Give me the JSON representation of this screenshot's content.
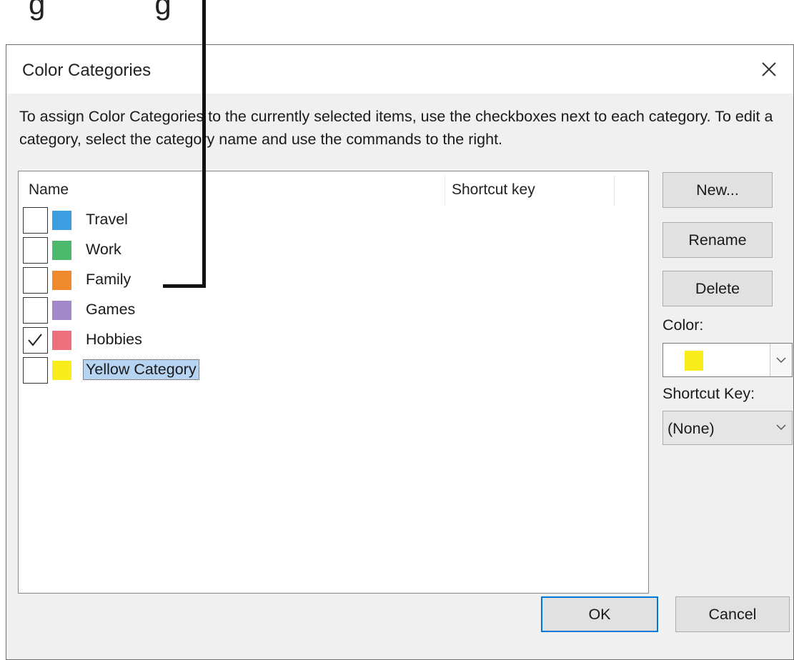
{
  "dialog": {
    "title": "Color Categories",
    "description": "To assign Color Categories to the currently selected items, use the checkboxes next to each category.  To edit a category, select the category name and use the commands to the right."
  },
  "list": {
    "columns": {
      "name": "Name",
      "shortcut": "Shortcut key"
    },
    "items": [
      {
        "label": "Travel",
        "color": "#3a9ee0",
        "checked": false,
        "selected": false
      },
      {
        "label": "Work",
        "color": "#4cb86c",
        "checked": false,
        "selected": false
      },
      {
        "label": "Family",
        "color": "#f08a2c",
        "checked": false,
        "selected": false
      },
      {
        "label": "Games",
        "color": "#a287c9",
        "checked": false,
        "selected": false
      },
      {
        "label": "Hobbies",
        "color": "#ee6f7c",
        "checked": true,
        "selected": false
      },
      {
        "label": "Yellow Category",
        "color": "#f8ec1a",
        "checked": false,
        "selected": true
      }
    ]
  },
  "buttons": {
    "new": "New...",
    "rename": "Rename",
    "delete": "Delete",
    "ok": "OK",
    "cancel": "Cancel"
  },
  "color_field": {
    "label": "Color:",
    "value_color": "#f8ec1a"
  },
  "shortcut_field": {
    "label": "Shortcut Key:",
    "value": "(None)"
  },
  "icons": {
    "close": "close-icon",
    "dropdown": "chevron-down-icon",
    "check": "check-icon"
  }
}
